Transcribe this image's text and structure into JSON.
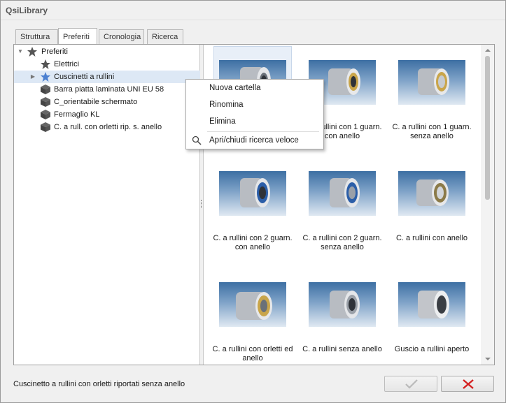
{
  "window": {
    "title": "QsiLibrary"
  },
  "tabs": [
    {
      "label": "Struttura",
      "active": false
    },
    {
      "label": "Preferiti",
      "active": true
    },
    {
      "label": "Cronologia",
      "active": false
    },
    {
      "label": "Ricerca",
      "active": false
    }
  ],
  "tree": [
    {
      "label": "Preferiti",
      "icon": "star-icon",
      "expanded": true
    },
    {
      "label": "Elettrici",
      "icon": "star-icon"
    },
    {
      "label": "Cuscinetti a rullini",
      "icon": "star-icon",
      "collapsed": true,
      "selected": true
    },
    {
      "label": "Barra piatta laminata UNI EU 58",
      "icon": "part-cube-icon"
    },
    {
      "label": "C_orientabile schermato",
      "icon": "part-cube-icon"
    },
    {
      "label": "Fermaglio KL",
      "icon": "part-cube-icon"
    },
    {
      "label": "C. a rull. con orletti rip. s. anello",
      "icon": "part-cube-icon"
    }
  ],
  "gallery": [
    {
      "label": "",
      "selected": true
    },
    {
      "label": "C. a rullini con 1 guarn. con anello"
    },
    {
      "label": "C. a rullini con 1 guarn. senza anello"
    },
    {
      "label": "C. a rullini con 2 guarn. con anello"
    },
    {
      "label": "C. a rullini con 2 guarn. senza anello"
    },
    {
      "label": "C. a rullini con anello"
    },
    {
      "label": "C. a rullini con orletti ed anello"
    },
    {
      "label": "C. a rullini senza anello"
    },
    {
      "label": "Guscio a rullini aperto"
    }
  ],
  "context_menu": {
    "items": [
      {
        "label": "Nuova cartella"
      },
      {
        "label": "Rinomina"
      },
      {
        "label": "Elimina"
      },
      {
        "label": "Apri/chiudi ricerca veloce",
        "icon": "search-icon"
      }
    ]
  },
  "status": {
    "text": "Cuscinetto a rullini  con orletti riportati senza anello"
  },
  "buttons": {
    "ok": "checkmark-icon",
    "cancel": "close-x-icon"
  },
  "colors": {
    "accent_star": "#4a7fd0",
    "cancel_red": "#d42020",
    "selection": "#dde8f5"
  }
}
